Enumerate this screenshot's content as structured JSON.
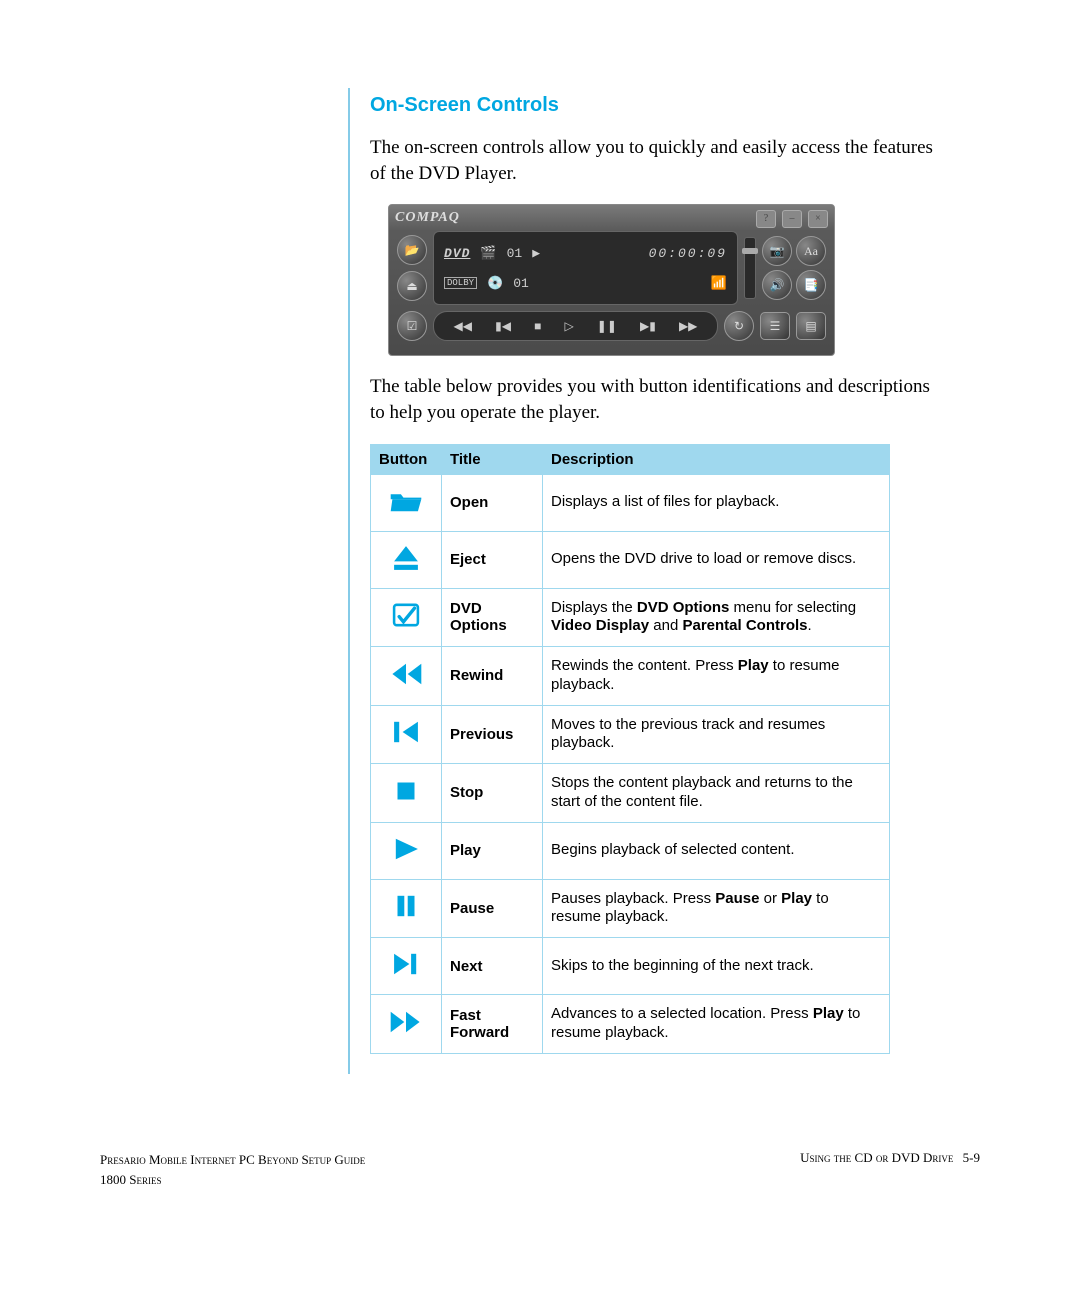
{
  "heading": "On-Screen Controls",
  "intro": "The on-screen controls allow you to quickly and easily access the features of the DVD Player.",
  "table_intro": "The table below provides you with button identifications and descriptions to help you operate the player.",
  "player": {
    "brand": "COMPAQ",
    "media_label": "DVD",
    "chapter": "01",
    "title_num": "01",
    "time": "00:00:09",
    "dolby": "DOLBY"
  },
  "table": {
    "headers": {
      "button": "Button",
      "title": "Title",
      "description": "Description"
    },
    "rows": [
      {
        "icon": "open",
        "title": "Open",
        "desc_parts": [
          {
            "t": "Displays a list of files for playback."
          }
        ]
      },
      {
        "icon": "eject",
        "title": "Eject",
        "desc_parts": [
          {
            "t": "Opens the DVD drive to load or remove discs."
          }
        ]
      },
      {
        "icon": "options",
        "title": "DVD Options",
        "desc_parts": [
          {
            "t": "Displays the "
          },
          {
            "b": true,
            "t": "DVD Options"
          },
          {
            "t": " menu for selecting "
          },
          {
            "b": true,
            "t": "Video Display"
          },
          {
            "t": " and "
          },
          {
            "b": true,
            "t": "Parental Controls"
          },
          {
            "t": "."
          }
        ]
      },
      {
        "icon": "rewind",
        "title": "Rewind",
        "desc_parts": [
          {
            "t": "Rewinds the content. Press "
          },
          {
            "b": true,
            "t": "Play"
          },
          {
            "t": " to resume playback."
          }
        ]
      },
      {
        "icon": "previous",
        "title": "Previous",
        "desc_parts": [
          {
            "t": "Moves to the previous track and resumes playback."
          }
        ]
      },
      {
        "icon": "stop",
        "title": "Stop",
        "desc_parts": [
          {
            "t": "Stops the content playback and returns to the start of the content file."
          }
        ]
      },
      {
        "icon": "play",
        "title": "Play",
        "desc_parts": [
          {
            "t": "Begins playback of selected content."
          }
        ]
      },
      {
        "icon": "pause",
        "title": "Pause",
        "desc_parts": [
          {
            "t": "Pauses playback. Press "
          },
          {
            "b": true,
            "t": "Pause"
          },
          {
            "t": " or "
          },
          {
            "b": true,
            "t": "Play"
          },
          {
            "t": " to resume playback."
          }
        ]
      },
      {
        "icon": "next",
        "title": "Next",
        "desc_parts": [
          {
            "t": "Skips to the beginning of the next track."
          }
        ]
      },
      {
        "icon": "fastforward",
        "title": "Fast Forward",
        "desc_parts": [
          {
            "t": "Advances to a selected location. Press "
          },
          {
            "b": true,
            "t": "Play"
          },
          {
            "t": " to resume playback."
          }
        ]
      }
    ]
  },
  "footer": {
    "left_line1_pre": "Presario",
    "left_line1_sc": " Mobile Internet PC Beyond Setup Guide",
    "left_line2": "1800 Series",
    "right_sc": "Using the CD or DVD Drive",
    "page": "5-9"
  },
  "colors": {
    "accent": "#00a7e1",
    "tableHeader": "#9fd8ee"
  }
}
